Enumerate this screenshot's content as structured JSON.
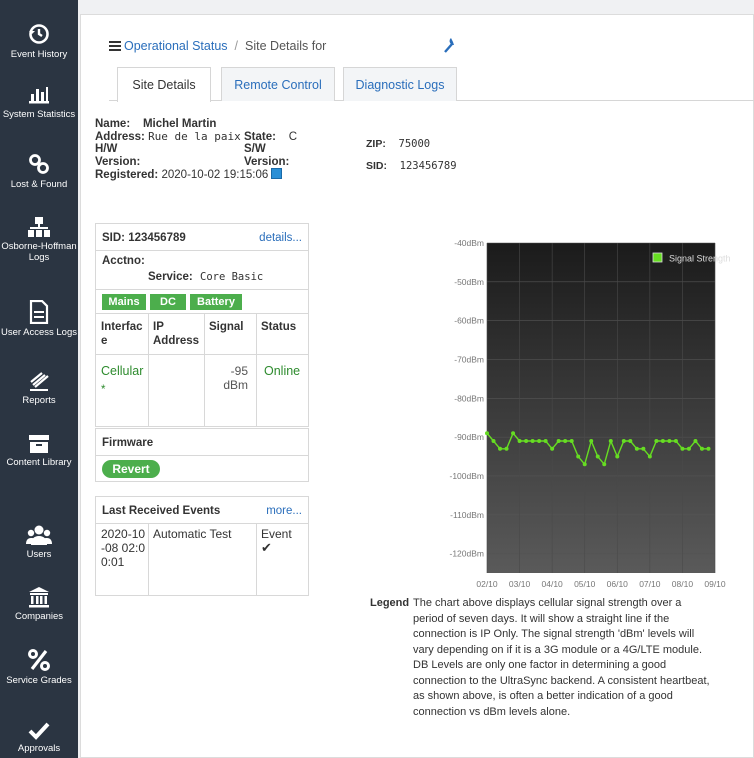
{
  "sidebar": {
    "items": [
      {
        "label": "Event History",
        "icon": "history-icon"
      },
      {
        "label": "System Statistics",
        "icon": "bar-chart-icon"
      },
      {
        "label": "Lost & Found",
        "icon": "link-icon"
      },
      {
        "label": "Osborne-Hoffman Logs",
        "icon": "network-icon"
      },
      {
        "label": "User Access Logs",
        "icon": "document-icon"
      },
      {
        "label": "Reports",
        "icon": "reports-icon"
      },
      {
        "label": "Content Library",
        "icon": "archive-icon"
      },
      {
        "label": "Users",
        "icon": "users-icon"
      },
      {
        "label": "Companies",
        "icon": "bank-icon"
      },
      {
        "label": "Service Grades",
        "icon": "percent-icon"
      },
      {
        "label": "Approvals",
        "icon": "check-icon"
      }
    ]
  },
  "breadcrumb": {
    "link": "Operational Status",
    "separator": "/",
    "current": "Site Details for"
  },
  "tabs": [
    {
      "label": "Site Details",
      "active": true
    },
    {
      "label": "Remote Control",
      "active": false
    },
    {
      "label": "Diagnostic Logs",
      "active": false
    }
  ],
  "site": {
    "name_label": "Name:",
    "name": "Michel Martin",
    "address_label": "Address:",
    "address": "Rue de la paix",
    "state_label": "State:",
    "state": "C",
    "hw_label": "H/W",
    "sw_label": "S/W",
    "version_label": "Version:",
    "version2_label": "Version:",
    "registered_label": "Registered:",
    "registered": "2020-10-02 19:15:06",
    "zip_label": "ZIP:",
    "zip": "75000",
    "sid_label": "SID:",
    "sid": "123456789"
  },
  "sid_box": {
    "sid_text": "SID: 123456789",
    "details_link": "details...",
    "acctno_label": "Acctno:",
    "service_label": "Service:",
    "service": "Core Basic",
    "power_badges": [
      "Mains",
      "DC",
      "Battery"
    ],
    "columns": [
      "Interfac e",
      "IP Address",
      "Signal",
      "Status"
    ],
    "row": {
      "interface": "Cellular",
      "marker": "*",
      "ip": "",
      "signal_value": "-95",
      "signal_unit": "dBm",
      "status": "Online"
    }
  },
  "firmware": {
    "title": "Firmware",
    "button": "Revert"
  },
  "events": {
    "title": "Last Received Events",
    "more_link": "more...",
    "row": {
      "date": "2020-10-08 02:00:01",
      "name": "Automatic Test",
      "type": "Event",
      "check": "✔"
    }
  },
  "colors": {
    "accent": "#2a6ebb",
    "badge_green": "#4cae4c",
    "sidebar_bg": "#2b3542",
    "series": "#66dd22"
  },
  "chart_data": {
    "type": "line",
    "ylim": [
      -125,
      -40
    ],
    "ytick_labels": [
      "-40dBm",
      "-50dBm",
      "-60dBm",
      "-70dBm",
      "-80dBm",
      "-90dBm",
      "-100dBm",
      "-110dBm",
      "-120dBm"
    ],
    "ytick_values": [
      -40,
      -50,
      -60,
      -70,
      -80,
      -90,
      -100,
      -110,
      -120
    ],
    "xtick_labels": [
      "02/10",
      "03/10",
      "04/10",
      "05/10",
      "06/10",
      "07/10",
      "08/10",
      "09/10"
    ],
    "legend_position": "top-right",
    "series": [
      {
        "name": "Signal Strength",
        "x": [
          2.0,
          2.2,
          2.4,
          2.6,
          2.8,
          3.0,
          3.2,
          3.4,
          3.6,
          3.8,
          4.0,
          4.2,
          4.4,
          4.6,
          4.8,
          5.0,
          5.2,
          5.4,
          5.6,
          5.8,
          6.0,
          6.2,
          6.4,
          6.6,
          6.8,
          7.0,
          7.2,
          7.4,
          7.6,
          7.8,
          8.0,
          8.2,
          8.4,
          8.6,
          8.8
        ],
        "values": [
          -89,
          -91,
          -93,
          -93,
          -89,
          -91,
          -91,
          -91,
          -91,
          -91,
          -93,
          -91,
          -91,
          -91,
          -95,
          -97,
          -91,
          -95,
          -97,
          -91,
          -95,
          -91,
          -91,
          -93,
          -93,
          -95,
          -91,
          -91,
          -91,
          -91,
          -93,
          -93,
          -91,
          -93,
          -93
        ]
      }
    ]
  },
  "legend": {
    "label": "Legend",
    "lines": [
      "The chart above displays cellular signal strength over a",
      "period of seven days. It will show a straight line if the",
      "connection is IP Only. The signal strength 'dBm' levels will",
      "vary depending on if it is a 3G module or a 4G/LTE module.",
      "DB Levels are only one factor in determining a good",
      "connection to the UltraSync backend. A consistent heartbeat,",
      "as shown above, is often a better indication of a good",
      "connection vs dBm levels alone."
    ]
  }
}
